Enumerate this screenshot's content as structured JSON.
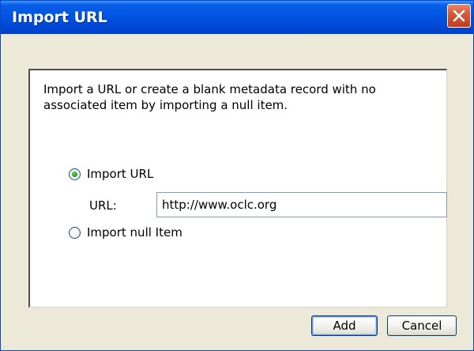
{
  "window": {
    "title": "Import URL"
  },
  "dialog": {
    "description": "Import a URL or create a blank metadata record with no associated item by importing a null item.",
    "option_url_label": "Import URL",
    "url_field_label": "URL:",
    "url_value": "http://www.oclc.org",
    "option_null_label": "Import null Item",
    "selected_option": "Import URL"
  },
  "buttons": {
    "add_label": "Add",
    "cancel_label": "Cancel"
  },
  "icons": {
    "close": "close-icon",
    "radio_checked": "radio-checked-icon",
    "radio_unchecked": "radio-unchecked-icon"
  },
  "colors": {
    "titlebar": "#0054e3",
    "close_button": "#d45a3a",
    "dialog_background": "#ece9d8",
    "radio_dot": "#21a121"
  }
}
